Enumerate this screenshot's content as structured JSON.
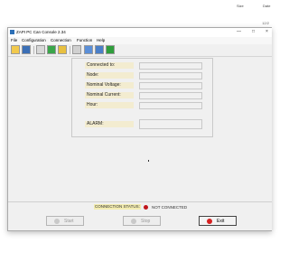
{
  "background": {
    "columns": [
      "Size",
      "Date"
    ],
    "sub": "12/2"
  },
  "window": {
    "title": "ZAPI PC Can Console 2.34",
    "controls": [
      "—",
      "□",
      "×"
    ]
  },
  "menu": [
    "File",
    "Configuration",
    "Connection",
    "Function",
    "Help"
  ],
  "toolbar": {
    "icons": [
      "open-folder-icon",
      "save-icon",
      "settings-icon",
      "connect-icon",
      "lock-icon",
      "tools-icon",
      "monitor-icon",
      "list-icon",
      "exit-icon"
    ]
  },
  "info": {
    "connected_to": "Connected to:",
    "node": "Node:",
    "nominal_voltage": "Nominal Voltage:",
    "nominal_current": "Nominal Current:",
    "hour": "Hour:",
    "alarm": "ALARM:"
  },
  "status": {
    "label": "CONNECTION STATUS:",
    "value": "NOT CONNECTED",
    "led_color": "#c0151b"
  },
  "buttons": {
    "start": "Start",
    "stop": "Stop",
    "exit": "Exit"
  }
}
